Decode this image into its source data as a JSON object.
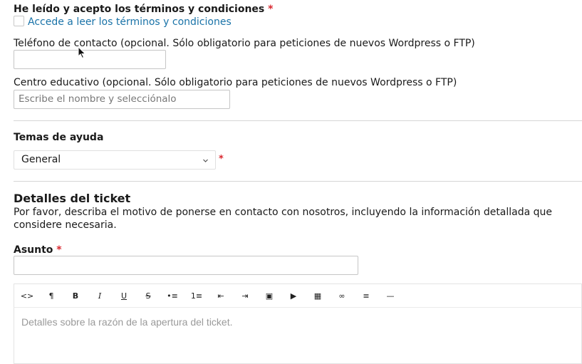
{
  "terms": {
    "label": "He leído y acepto los términos y condiciones",
    "required_mark": "*",
    "link_text": "Accede a leer los términos y condiciones"
  },
  "phone": {
    "label": "Teléfono de contacto (opcional. Sólo obligatorio para peticiones de nuevos Wordpress o FTP)",
    "value": ""
  },
  "school": {
    "label": "Centro educativo (opcional. Sólo obligatorio para peticiones de nuevos Wordpress o FTP)",
    "placeholder": "Escribe el nombre y selecciónalo"
  },
  "help_topics": {
    "label": "Temas de ayuda",
    "selected": "General",
    "required_mark": "*"
  },
  "ticket_details": {
    "title": "Detalles del ticket",
    "description": "Por favor, describa el motivo de ponerse en contacto con nosotros, incluyendo la información detallada que considere necesaria."
  },
  "subject": {
    "label": "Asunto",
    "required_mark": "*",
    "value": ""
  },
  "editor": {
    "toolbar": [
      {
        "name": "code-view-icon",
        "glyph": "<>"
      },
      {
        "name": "paragraph-icon",
        "glyph": "¶"
      },
      {
        "name": "bold-icon",
        "glyph": "B"
      },
      {
        "name": "italic-icon",
        "glyph": "I"
      },
      {
        "name": "underline-icon",
        "glyph": "U"
      },
      {
        "name": "strikethrough-icon",
        "glyph": "S"
      },
      {
        "name": "bulleted-list-icon",
        "glyph": "•≡"
      },
      {
        "name": "numbered-list-icon",
        "glyph": "1≡"
      },
      {
        "name": "outdent-icon",
        "glyph": "⇤"
      },
      {
        "name": "indent-icon",
        "glyph": "⇥"
      },
      {
        "name": "image-icon",
        "glyph": "▣"
      },
      {
        "name": "video-icon",
        "glyph": "▶"
      },
      {
        "name": "table-icon",
        "glyph": "▦"
      },
      {
        "name": "link-icon",
        "glyph": "∞"
      },
      {
        "name": "align-icon",
        "glyph": "≡"
      },
      {
        "name": "horizontal-rule-icon",
        "glyph": "—"
      }
    ],
    "placeholder": "Detalles sobre la razón de la apertura del ticket."
  }
}
